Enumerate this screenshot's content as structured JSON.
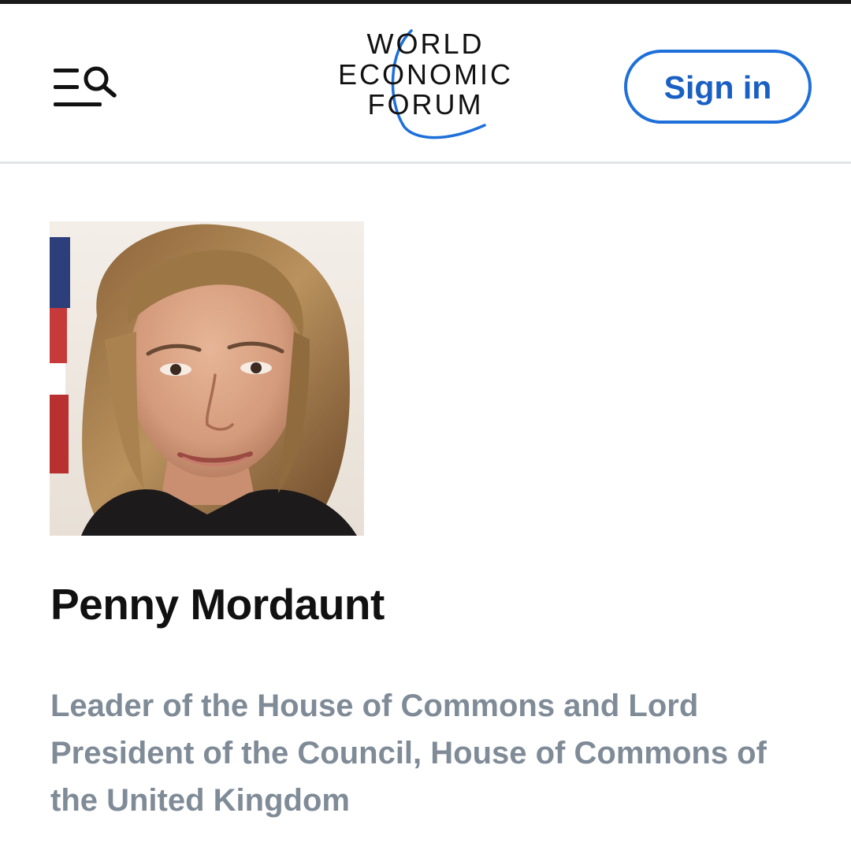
{
  "header": {
    "menu_icon": "menu-lines-icon",
    "search_icon": "search-icon",
    "logo": {
      "lines": [
        "WORLD",
        "ECONOMIC",
        "FORUM"
      ],
      "text_color": "#111111",
      "arc_color": "#1e6fd9"
    },
    "signin_label": "Sign in",
    "accent_color": "#1e6fd9"
  },
  "profile": {
    "photo_alt": "Penny Mordaunt",
    "name": "Penny Mordaunt",
    "role": "Leader of the House of Commons and Lord President of the Council, House of Commons of the United Kingdom",
    "role_color": "#7f8b97"
  }
}
